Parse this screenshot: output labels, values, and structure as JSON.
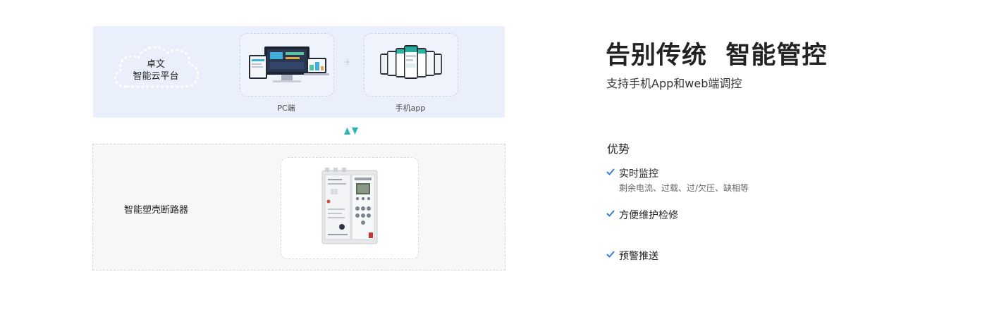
{
  "cloud": {
    "line1": "卓文",
    "line2": "智能云平台"
  },
  "devices": {
    "pc_label": "PC端",
    "app_label": "手机app",
    "plus": "+"
  },
  "breaker": {
    "name": "智能塑壳断路器"
  },
  "hero": {
    "headline": "告别传统  智能管控",
    "subline": "支持手机App和web端调控"
  },
  "advantages": {
    "title": "优势",
    "items": [
      {
        "title": "实时监控",
        "desc": "剩余电流、过载、过/欠压、缺相等"
      },
      {
        "title": "方便维护检修",
        "desc": ""
      },
      {
        "title": "预警推送",
        "desc": ""
      }
    ]
  },
  "colors": {
    "panel_bg": "#e9f0fb",
    "accent_teal": "#2bb5b5",
    "check_blue": "#3a7bd5"
  }
}
